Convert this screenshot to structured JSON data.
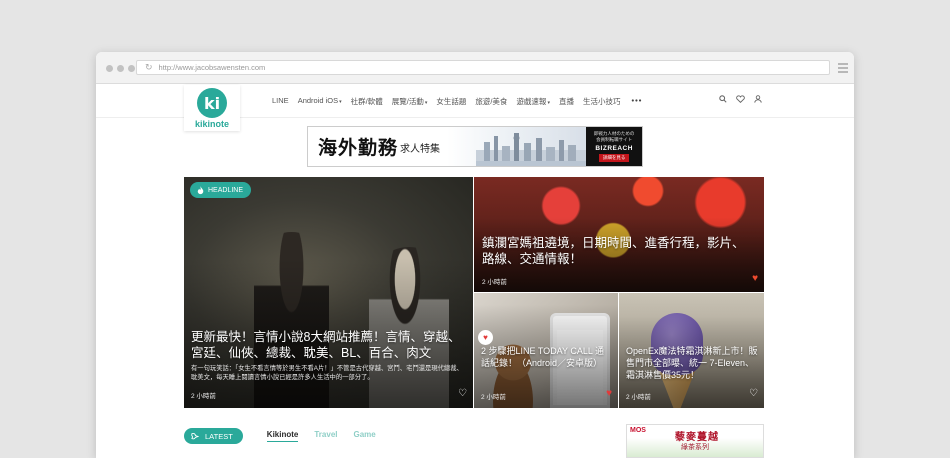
{
  "browser": {
    "url": "http://www.jacobsawensten.com"
  },
  "site": {
    "logo_text": "kikinote",
    "logo_letter": "ki",
    "menu": [
      {
        "label": "LINE",
        "dropdown": false
      },
      {
        "label": "Android iOS",
        "dropdown": true
      },
      {
        "label": "社群/軟體",
        "dropdown": false
      },
      {
        "label": "展覽/活動",
        "dropdown": true
      },
      {
        "label": "女生話題",
        "dropdown": false
      },
      {
        "label": "旅遊/美食",
        "dropdown": false
      },
      {
        "label": "遊戲速報",
        "dropdown": true
      },
      {
        "label": "直播",
        "dropdown": false
      },
      {
        "label": "生活小技巧",
        "dropdown": false
      }
    ],
    "more_label": "•••",
    "icons": [
      "search-icon",
      "heart-icon",
      "user-icon"
    ]
  },
  "banner": {
    "title": "海外勤務",
    "subtitle": "求人特集",
    "right_text": "即戦力人材のための\n会員制転職サイト",
    "brand": "BIZREACH",
    "cta": "詳細を見る"
  },
  "featured": {
    "main": {
      "tag": "HEADLINE",
      "title": "更新最快！言情小說8大網站推薦！言情、穿越、宮廷、仙俠、總裁、耽美、BL、百合、肉文",
      "excerpt": "有一句玩笑話：「女生不看言情等於男生不看A片！」不管是古代穿越、宮鬥、宅鬥還是現代總裁、耽美文，每天睡上閱讀言情小說已經是許多人生活中的一部分了。",
      "time": "2 小時前"
    },
    "top": {
      "title": "鎮瀾宮媽祖遶境，日期時間、進香行程，影片、路線、交通情報！",
      "time": "2 小時前"
    },
    "mid": {
      "title": "2 步驟把LINE TODAY CALL 通話紀錄！（Android／安卓版）",
      "time": "2 小時前"
    },
    "right": {
      "title": "OpenEx魔法特霜淇淋新上市！販售門市全部曝、統一 7-Eleven、霜淇淋售價35元！",
      "time": "2 小時前"
    }
  },
  "latest": {
    "label": "LATEST",
    "tabs": [
      "Kikinote",
      "Travel",
      "Game"
    ],
    "active_tab": "Kikinote"
  },
  "side_ad": {
    "brand": "MOS",
    "title": "藜麥蔓越",
    "subtitle": "綠茶系列"
  },
  "colors": {
    "brand": "#2aa99a",
    "accent_red": "#e23a3a"
  }
}
